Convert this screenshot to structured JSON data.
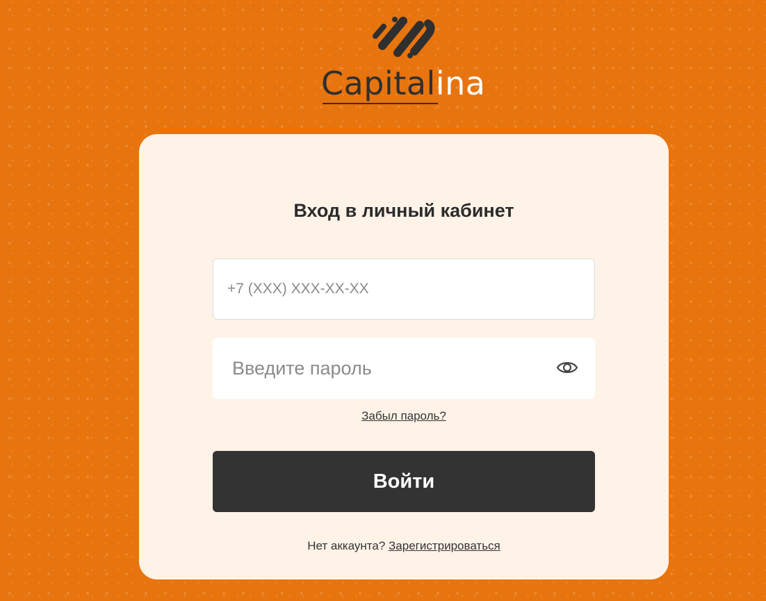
{
  "brand": {
    "name_dark": "Capital",
    "name_light": "ina",
    "logo_icon": "capitalina-logo-mark"
  },
  "login": {
    "title": "Вход в личный кабинет",
    "phone_placeholder": "+7 (XXX) XXX-XX-XX",
    "phone_value": "",
    "password_placeholder": "Введите пароль",
    "password_value": "",
    "show_password_icon": "eye-icon",
    "forgot_password": "Забыл пароль?",
    "submit_label": "Войти",
    "no_account": "Нет аккаунта?",
    "register_link": "Зарегистрироваться"
  },
  "colors": {
    "background": "#e8740e",
    "card": "#fff3e8",
    "button": "#333333",
    "text": "#2b2b2b"
  }
}
